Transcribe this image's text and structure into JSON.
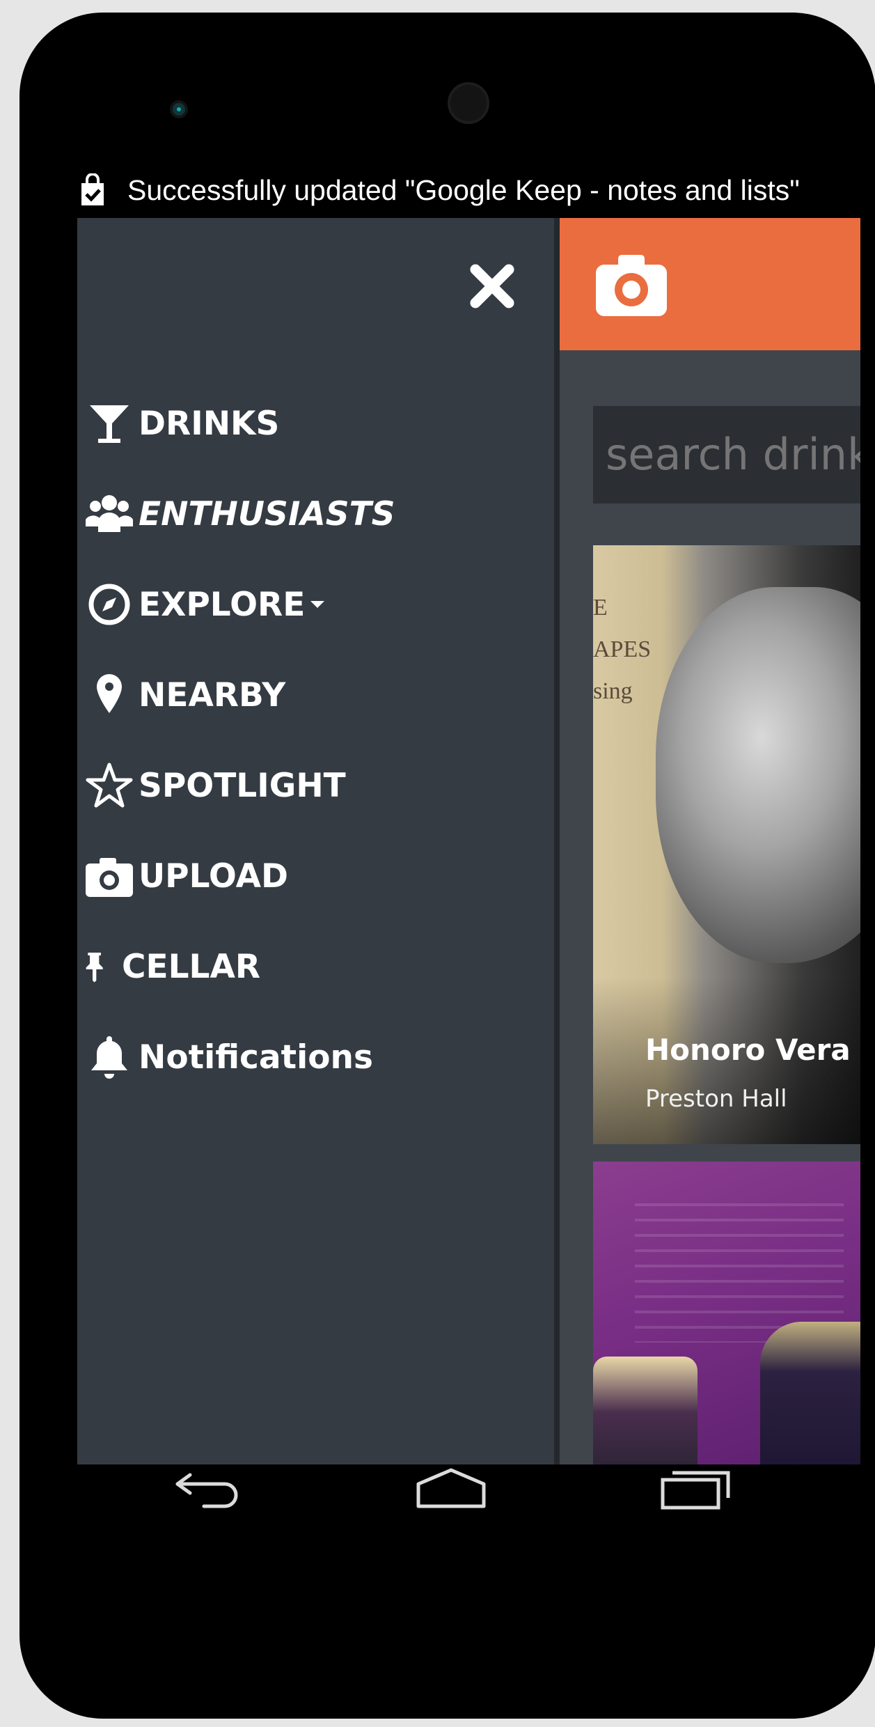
{
  "status_bar": {
    "notification_text": "Successfully updated \"Google Keep - notes and lists\""
  },
  "drawer": {
    "items": [
      {
        "label": "DRINKS",
        "icon": "cocktail-glass-icon"
      },
      {
        "label": "ENTHUSIASTS",
        "icon": "users-icon"
      },
      {
        "label": "EXPLORE",
        "icon": "compass-icon"
      },
      {
        "label": "NEARBY",
        "icon": "map-pin-icon"
      },
      {
        "label": "SPOTLIGHT",
        "icon": "star-outline-icon"
      },
      {
        "label": "UPLOAD",
        "icon": "camera-icon"
      },
      {
        "label": "CELLAR",
        "icon": "pushpin-icon"
      },
      {
        "label": "Notifications",
        "icon": "bell-icon"
      }
    ]
  },
  "main": {
    "search_placeholder": "search drinks",
    "cards": [
      {
        "title": "Honoro Vera",
        "subtitle": "Preston Hall",
        "image_text": "E\nAPES\nsing"
      },
      {
        "title": "",
        "subtitle": ""
      }
    ]
  },
  "colors": {
    "accent": "#ea6d3f",
    "drawer_bg": "#353b43",
    "main_bg": "#40454c"
  }
}
